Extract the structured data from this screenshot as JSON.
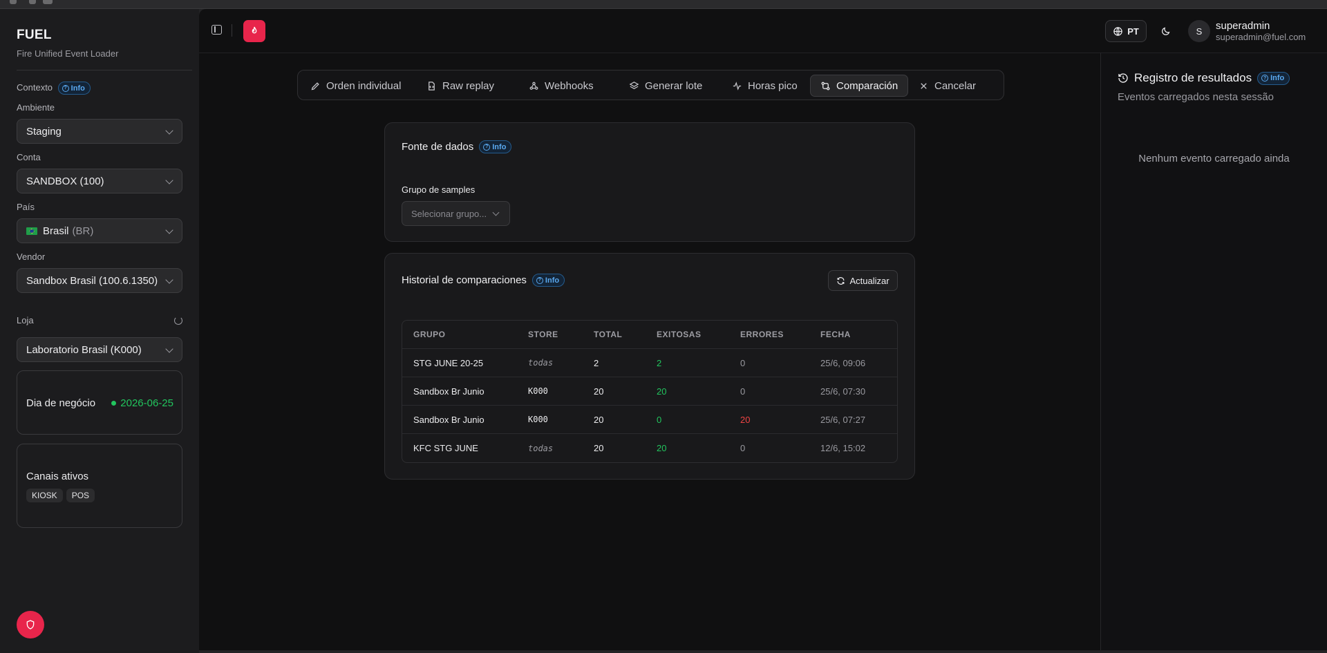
{
  "sidebar": {
    "brand_title": "FUEL",
    "brand_subtitle": "Fire Unified Event Loader",
    "context_label": "Contexto",
    "info_label": "Info",
    "environment_label": "Ambiente",
    "environment_value": "Staging",
    "account_label": "Conta",
    "account_value": "SANDBOX (100)",
    "country_label": "País",
    "country_value": "Brasil",
    "country_code": "(BR)",
    "vendor_label": "Vendor",
    "vendor_value": "Sandbox Brasil (100.6.1350)",
    "store_label": "Loja",
    "store_value": "Laboratorio Brasil (K000)",
    "business_day_label": "Dia de negócio",
    "business_day_value": "2026-06-25",
    "channels_label": "Canais ativos",
    "channels": [
      "KIOSK",
      "POS"
    ]
  },
  "header": {
    "language": "PT",
    "user_initial": "S",
    "user_name": "superadmin",
    "user_email": "superadmin@fuel.com"
  },
  "tabs": [
    {
      "label": "Orden individual",
      "icon": "pencil-icon"
    },
    {
      "label": "Raw replay",
      "icon": "file-code-icon"
    },
    {
      "label": "Webhooks",
      "icon": "webhook-icon"
    },
    {
      "label": "Generar lote",
      "icon": "layers-icon"
    },
    {
      "label": "Horas pico",
      "icon": "activity-icon"
    },
    {
      "label": "Comparación",
      "icon": "git-compare-icon",
      "active": true
    },
    {
      "label": "Cancelar",
      "icon": "close-icon"
    }
  ],
  "data_source": {
    "title": "Fonte de dados",
    "info_label": "Info",
    "group_label": "Grupo de samples",
    "group_placeholder": "Selecionar grupo..."
  },
  "history": {
    "title": "Historial de comparaciones",
    "info_label": "Info",
    "refresh_label": "Actualizar",
    "columns": [
      "GRUPO",
      "STORE",
      "TOTAL",
      "EXITOSAS",
      "ERRORES",
      "FECHA"
    ],
    "rows": [
      {
        "grupo": "STG JUNE 20-25",
        "store": "todas",
        "total": "2",
        "exitosas": "2",
        "errores": "0",
        "fecha": "25/6, 09:06"
      },
      {
        "grupo": "Sandbox Br Junio",
        "store": "K000",
        "total": "20",
        "exitosas": "20",
        "errores": "0",
        "fecha": "25/6, 07:30"
      },
      {
        "grupo": "Sandbox Br Junio",
        "store": "K000",
        "total": "20",
        "exitosas": "0",
        "errores": "20",
        "fecha": "25/6, 07:27"
      },
      {
        "grupo": "KFC STG JUNE",
        "store": "todas",
        "total": "20",
        "exitosas": "20",
        "errores": "0",
        "fecha": "12/6, 15:02"
      }
    ]
  },
  "results_log": {
    "title": "Registro de resultados",
    "info_label": "Info",
    "subtitle": "Eventos carregados nesta sessão",
    "empty": "Nenhum evento carregado ainda"
  },
  "colors": {
    "accent": "#e8254b",
    "success": "#22c55e",
    "error": "#ef4444",
    "info": "#5aa9f0"
  }
}
